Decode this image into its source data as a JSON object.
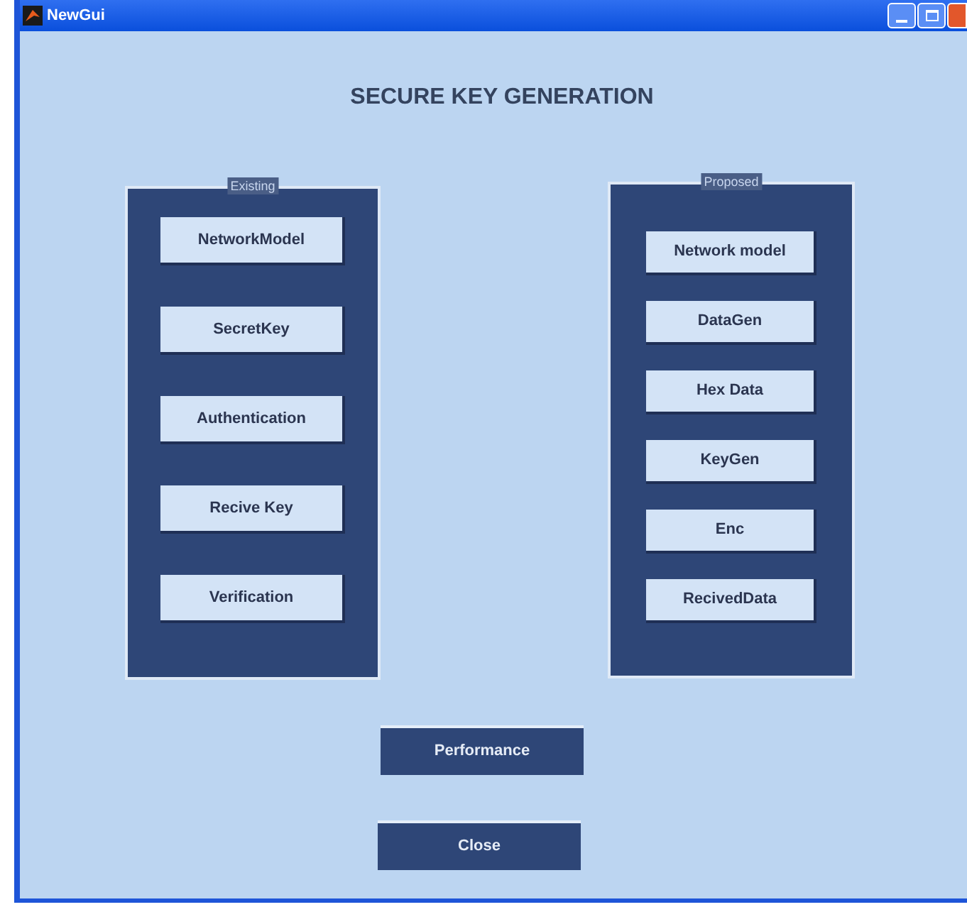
{
  "window": {
    "title": "NewGui"
  },
  "heading": "SECURE KEY GENERATION",
  "panels": [
    {
      "title": "Existing",
      "buttons": [
        "NetworkModel",
        "SecretKey",
        "Authentication",
        "Recive Key",
        "Verification"
      ]
    },
    {
      "title": "Proposed",
      "buttons": [
        "Network model",
        "DataGen",
        "Hex Data",
        "KeyGen",
        "Enc",
        "RecivedData"
      ]
    }
  ],
  "actions": [
    "Performance",
    "Close"
  ]
}
